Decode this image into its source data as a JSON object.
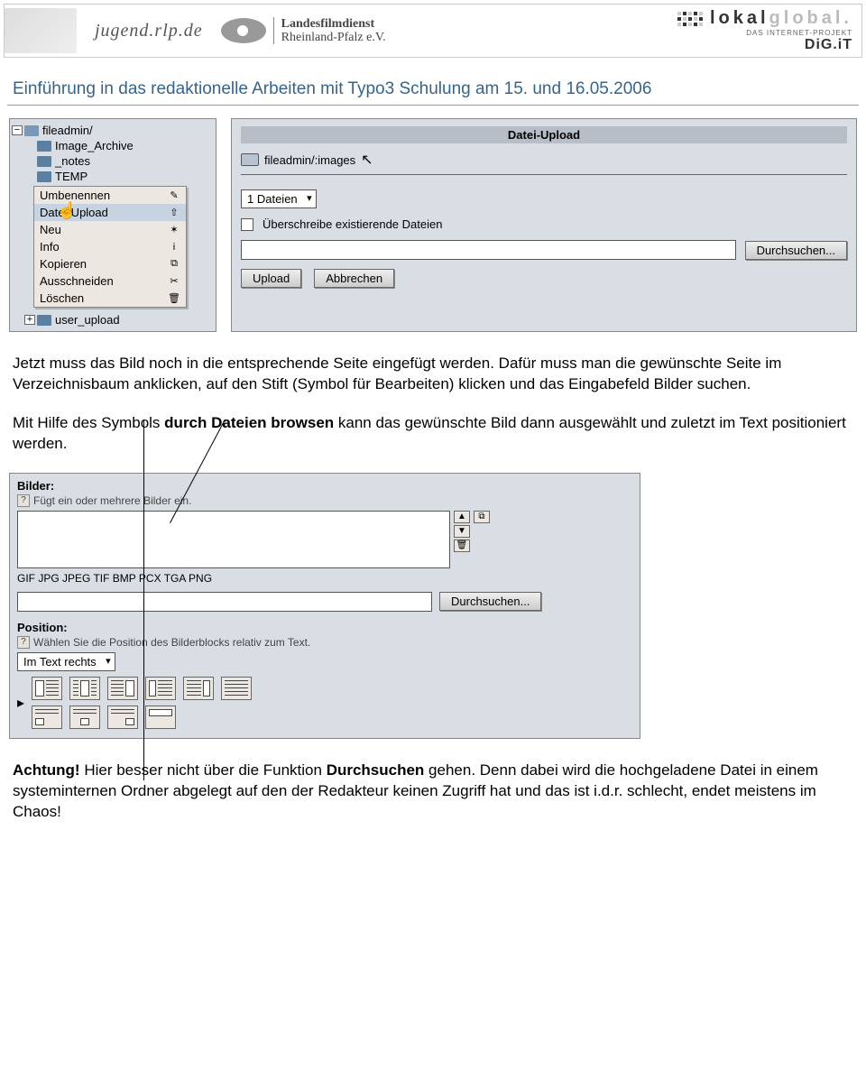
{
  "header": {
    "jugend": "jugend.rlp.de",
    "lfd_line1": "Landesfilmdienst",
    "lfd_line2": "Rheinland-Pfalz e.V.",
    "lokal": "lokal",
    "global": "global.",
    "lokal_sub": "DAS INTERNET-PROJEKT",
    "digit": "DiG.iT"
  },
  "page_title": "Einführung in das redaktionelle Arbeiten mit Typo3 Schulung am 15. und 16.05.2006",
  "tree": {
    "root": "fileadmin/",
    "items": [
      "Image_Archive",
      "_notes",
      "TEMP"
    ],
    "last": "user_upload",
    "ctx": {
      "umbenennen": "Umbenennen",
      "upload": "Datei-Upload",
      "neu": "Neu",
      "info": "Info",
      "kopieren": "Kopieren",
      "ausschneiden": "Ausschneiden",
      "loeschen": "Löschen"
    }
  },
  "upload": {
    "title": "Datei-Upload",
    "path": "fileadmin/:images",
    "dd": "1 Dateien",
    "overwrite": "Überschreibe existierende Dateien",
    "browse": "Durchsuchen...",
    "upload_btn": "Upload",
    "cancel_btn": "Abbrechen"
  },
  "para1_a": "Jetzt muss das Bild noch in die entsprechende Seite eingefügt werden. Dafür muss man die gewünschte Seite im Verzeichnisbaum anklicken, auf den Stift (Symbol für Bearbeiten) klicken und das Eingabefeld Bilder suchen.",
  "para2_a": "Mit Hilfe des Symbols ",
  "para2_b": "durch Dateien browsen",
  "para2_c": " kann das gewünschte Bild dann ausgewählt und zuletzt im Text positioniert werden.",
  "bilder": {
    "head": "Bilder:",
    "hint": "Fügt ein oder mehrere Bilder ein.",
    "formats": "GIF JPG JPEG TIF BMP PCX TGA PNG",
    "browse": "Durchsuchen...",
    "pos_head": "Position:",
    "pos_hint": "Wählen Sie die Position des Bilderblocks relativ zum Text.",
    "pos_dd": "Im Text rechts"
  },
  "para3_a": "Achtung!",
  "para3_b": " Hier besser nicht über die Funktion ",
  "para3_c": "Durchsuchen",
  "para3_d": " gehen. Denn dabei wird die hochgeladene Datei in einem systeminternen Ordner abgelegt auf den der Redakteur keinen Zugriff hat und das ist i.d.r. schlecht, endet meistens im Chaos!"
}
